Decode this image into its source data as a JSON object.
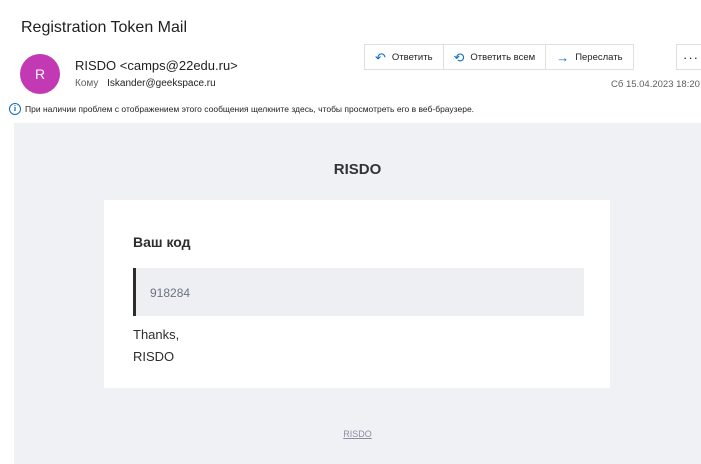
{
  "email": {
    "subject": "Registration Token Mail",
    "avatar_initial": "R",
    "sender": "RISDO <camps@22edu.ru>",
    "to_label": "Кому",
    "to_value": "Iskander@geekspace.ru",
    "date": "Сб 15.04.2023 18:20",
    "info_text": "При наличии проблем с отображением этого сообщения щелкните здесь, чтобы просмотреть его в веб-браузере."
  },
  "actions": {
    "reply_label": "Ответить",
    "reply_all_label": "Ответить всем",
    "forward_label": "Переслать",
    "more_label": "···"
  },
  "message": {
    "brand": "RISDO",
    "code_heading": "Ваш код",
    "code": "918284",
    "thanks": "Thanks,",
    "signature": "RISDO",
    "footer_link": "RISDO"
  },
  "colors": {
    "avatar": "#c239b3",
    "accent": "#0f6cbd",
    "body_bg": "#f0f1f4"
  }
}
